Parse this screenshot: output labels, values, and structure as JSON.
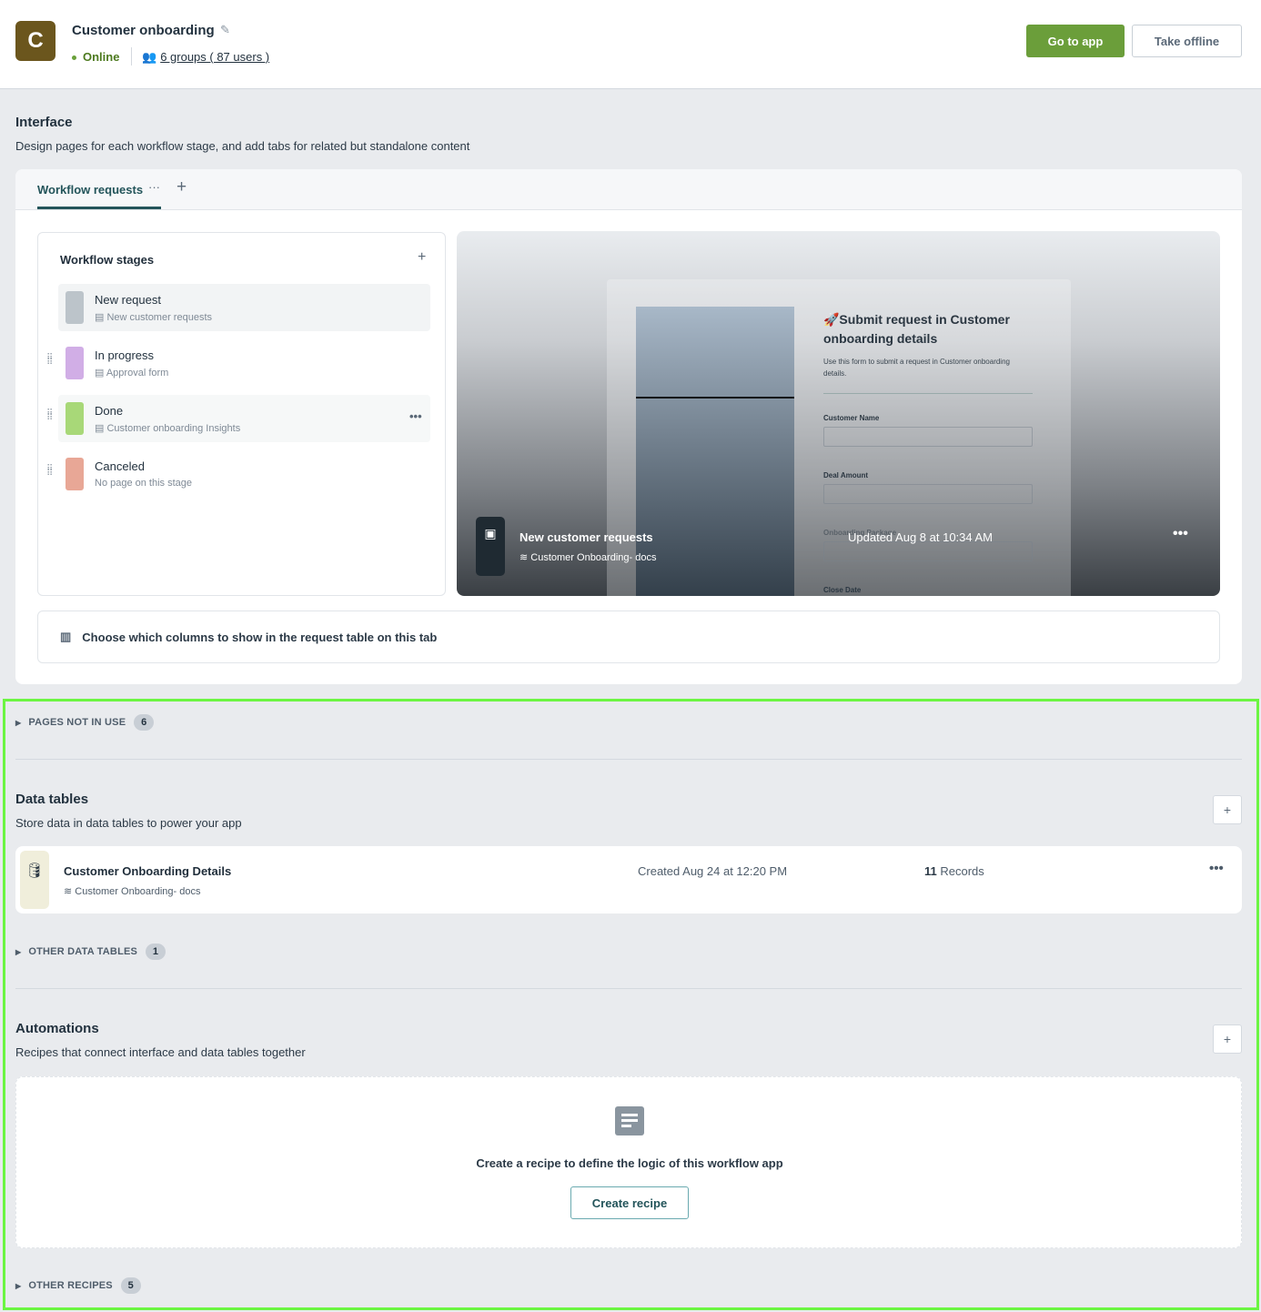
{
  "app": {
    "logo_letter": "C",
    "title": "Customer onboarding",
    "status": "Online",
    "users_link": "6 groups ( 87 users )",
    "go_to_app": "Go to app",
    "take_offline": "Take offline",
    "logo_color": "#6b561d",
    "accent_color": "#6b9e3a"
  },
  "interface": {
    "title": "Interface",
    "subtitle": "Design pages for each workflow stage, and add tabs for related but standalone content",
    "tabs": [
      {
        "label": "Workflow requests",
        "active": true
      }
    ],
    "stages_title": "Workflow stages",
    "stages": [
      {
        "name": "New request",
        "page": "New customer requests",
        "color": "#bcc4ca"
      },
      {
        "name": "In progress",
        "page": "Approval form",
        "color": "#d1aee6"
      },
      {
        "name": "Done",
        "page": "Customer onboarding Insights",
        "color": "#a8d878"
      },
      {
        "name": "Canceled",
        "page": "No page on this stage",
        "color": "#e8a796"
      }
    ],
    "preview": {
      "form_title": "🚀Submit request in Customer onboarding details",
      "form_desc": "Use this form to submit a request in Customer onboarding details.",
      "fields": [
        "Customer Name",
        "Deal Amount",
        "Onboarding Package",
        "Close Date"
      ],
      "page_name": "New customer requests",
      "source": "Customer Onboarding- docs",
      "updated": "Updated Aug 8 at 10:34 AM"
    },
    "columns_hint": "Choose which columns to show in the request table on this tab"
  },
  "pages_not_in_use": {
    "label": "PAGES NOT IN USE",
    "count": "6"
  },
  "data_tables": {
    "title": "Data tables",
    "subtitle": "Store data in data tables to power your app",
    "items": [
      {
        "name": "Customer Onboarding Details",
        "source": "Customer Onboarding- docs",
        "created": "Created Aug 24 at 12:20 PM",
        "records_count": "11",
        "records_label": "Records"
      }
    ],
    "other": {
      "label": "OTHER DATA TABLES",
      "count": "1"
    }
  },
  "automations": {
    "title": "Automations",
    "subtitle": "Recipes that connect interface and data tables together",
    "empty_text": "Create a recipe to define the logic of this workflow app",
    "create_button": "Create recipe",
    "other": {
      "label": "OTHER RECIPES",
      "count": "5"
    }
  }
}
